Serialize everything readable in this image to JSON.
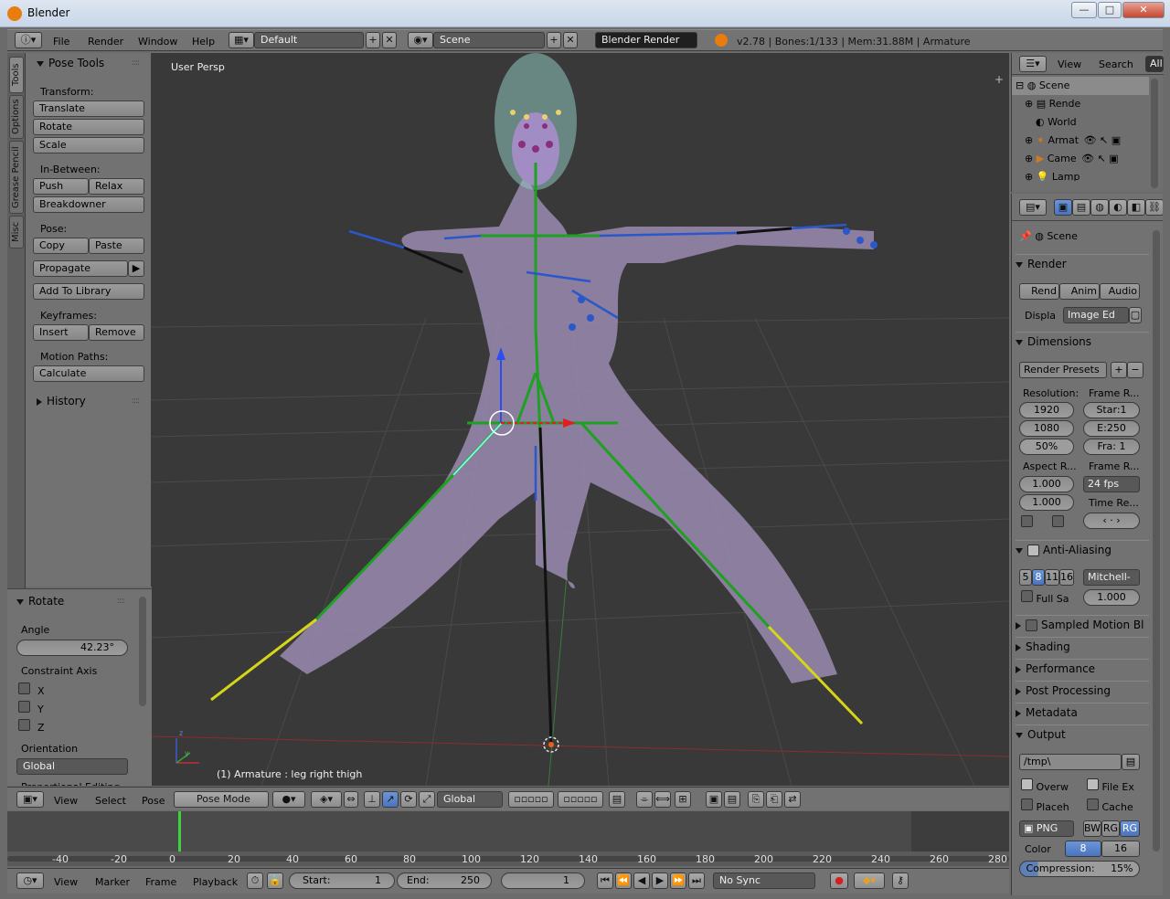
{
  "window": {
    "title": "Blender",
    "min_label": "—",
    "max_label": "□",
    "close_label": "✕"
  },
  "info": {
    "menus": [
      "File",
      "Render",
      "Window",
      "Help"
    ],
    "layout": "Default",
    "scene": "Scene",
    "engine": "Blender Render",
    "stats": "v2.78 | Bones:1/133 | Mem:31.88M | Armature"
  },
  "tabs": [
    "Tools",
    "Options",
    "Grease Pencil",
    "Misc"
  ],
  "tools": {
    "title": "Pose Tools",
    "transform_label": "Transform:",
    "translate": "Translate",
    "rotate": "Rotate",
    "scale": "Scale",
    "inbetween_label": "In-Between:",
    "push": "Push",
    "relax": "Relax",
    "breakdowner": "Breakdowner",
    "pose_label": "Pose:",
    "copy": "Copy",
    "paste": "Paste",
    "propagate": "Propagate",
    "add_library": "Add To Library",
    "keyframes_label": "Keyframes:",
    "insert": "Insert",
    "remove": "Remove",
    "motion_label": "Motion Paths:",
    "calculate": "Calculate",
    "history": "History"
  },
  "operator": {
    "title": "Rotate",
    "angle_label": "Angle",
    "angle_value": "42.23°",
    "constraint_label": "Constraint Axis",
    "x": "X",
    "y": "Y",
    "z": "Z",
    "orientation_label": "Orientation",
    "orientation_value": "Global",
    "cut_label": "Proportional Editing"
  },
  "viewport": {
    "view_label": "User Persp",
    "status": "(1) Armature : leg right thigh",
    "axis_z": "z",
    "axis_y": "y"
  },
  "header3d": {
    "view": "View",
    "select": "Select",
    "pose": "Pose",
    "mode": "Pose Mode",
    "orientation": "Global"
  },
  "timeline": {
    "ticks": [
      "-40",
      "-20",
      "0",
      "20",
      "40",
      "60",
      "80",
      "100",
      "120",
      "140",
      "160",
      "180",
      "200",
      "220",
      "240",
      "260",
      "280"
    ],
    "current_frame": 0
  },
  "bottom": {
    "view": "View",
    "marker": "Marker",
    "frame": "Frame",
    "playback": "Playback",
    "start_label": "Start:",
    "start_value": "1",
    "end_label": "End:",
    "end_value": "250",
    "current": "1",
    "sync": "No Sync"
  },
  "outliner": {
    "view": "View",
    "search": "Search",
    "filter": "All",
    "items": [
      "Scene",
      "Rende",
      "World",
      "Armat",
      "Came",
      "Lamp"
    ]
  },
  "props": {
    "scene": "Scene",
    "render_title": "Render",
    "render_btn": "Rend",
    "anim_btn": "Anim",
    "audio_btn": "Audio",
    "display_label": "Displa",
    "display_value": "Image Ed",
    "dimensions_title": "Dimensions",
    "presets": "Render Presets",
    "resolution_label": "Resolution:",
    "res_x": "1920",
    "res_y": "1080",
    "res_pct": "50%",
    "frame_range_label": "Frame R...",
    "start": "Star:1",
    "end": "E:250",
    "frame_step": "Fra: 1",
    "aspect_label": "Aspect R...",
    "aspect_x": "1.000",
    "aspect_y": "1.000",
    "frame_rate_label": "Frame R...",
    "fps": "24 fps",
    "time_label": "Time Re...",
    "aa_title": "Anti-Aliasing",
    "aa_samples": [
      "5",
      "8",
      "11",
      "16"
    ],
    "aa_filter": "Mitchell-",
    "full_sample": "Full Sa",
    "aa_size": "1.000",
    "motion_blur": "Sampled Motion Bl",
    "shading": "Shading",
    "performance": "Performance",
    "post": "Post Processing",
    "metadata": "Metadata",
    "output_title": "Output",
    "output_path": "/tmp\\",
    "overwrite": "Overw",
    "file_ext": "File Ex",
    "placeholders": "Placeh",
    "cache": "Cache",
    "format": "PNG",
    "bw": "BW",
    "rgb": "RG",
    "rgba": "RG",
    "color_label": "Color",
    "depth8": "8",
    "depth16": "16",
    "compression": "Compression:",
    "compression_value": "15%"
  }
}
